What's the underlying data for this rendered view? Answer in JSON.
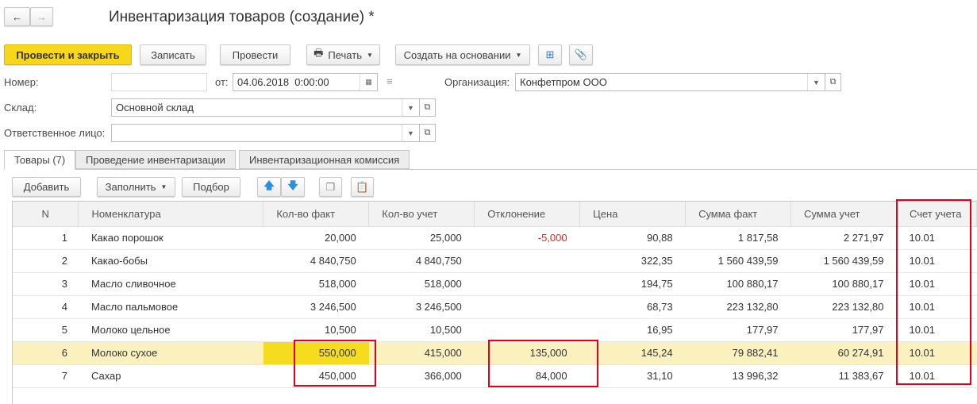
{
  "title": "Инвентаризация товаров (создание) *",
  "nav": {
    "back": "←",
    "forward": "→"
  },
  "toolbar": {
    "post_close": "Провести и закрыть",
    "save": "Записать",
    "post": "Провести",
    "print": "Печать",
    "create_based": "Создать на основании"
  },
  "form": {
    "number_label": "Номер:",
    "number_value": "",
    "date_label": "от:",
    "date_value": "04.06.2018  0:00:00",
    "org_label": "Организация:",
    "org_value": "Конфетпром ООО",
    "warehouse_label": "Склад:",
    "warehouse_value": "Основной склад",
    "person_label": "Ответственное лицо:",
    "person_value": ""
  },
  "tabs": [
    "Товары (7)",
    "Проведение инвентаризации",
    "Инвентаризационная комиссия"
  ],
  "table_toolbar": {
    "add": "Добавить",
    "fill": "Заполнить",
    "pick": "Подбор"
  },
  "columns": [
    "N",
    "Номенклатура",
    "Кол-во факт",
    "Кол-во учет",
    "Отклонение",
    "Цена",
    "Сумма факт",
    "Сумма учет",
    "Счет учета"
  ],
  "rows": [
    [
      "1",
      "Какао порошок",
      "20,000",
      "25,000",
      "-5,000",
      "90,88",
      "1 817,58",
      "2 271,97",
      "10.01"
    ],
    [
      "2",
      "Какао-бобы",
      "4 840,750",
      "4 840,750",
      "",
      "322,35",
      "1 560 439,59",
      "1 560 439,59",
      "10.01"
    ],
    [
      "3",
      "Масло сливочное",
      "518,000",
      "518,000",
      "",
      "194,75",
      "100 880,17",
      "100 880,17",
      "10.01"
    ],
    [
      "4",
      "Масло пальмовое",
      "3 246,500",
      "3 246,500",
      "",
      "68,73",
      "223 132,80",
      "223 132,80",
      "10.01"
    ],
    [
      "5",
      "Молоко цельное",
      "10,500",
      "10,500",
      "",
      "16,95",
      "177,97",
      "177,97",
      "10.01"
    ],
    [
      "6",
      "Молоко сухое",
      "550,000",
      "415,000",
      "135,000",
      "145,24",
      "79 882,41",
      "60 274,91",
      "10.01"
    ],
    [
      "7",
      "Сахар",
      "450,000",
      "366,000",
      "84,000",
      "31,10",
      "13 996,32",
      "11 383,67",
      "10.01"
    ]
  ],
  "selected_row": 6,
  "colors": {
    "accent": "#f7d61b",
    "highlight": "#e3001b",
    "negative": "#e0261d"
  }
}
